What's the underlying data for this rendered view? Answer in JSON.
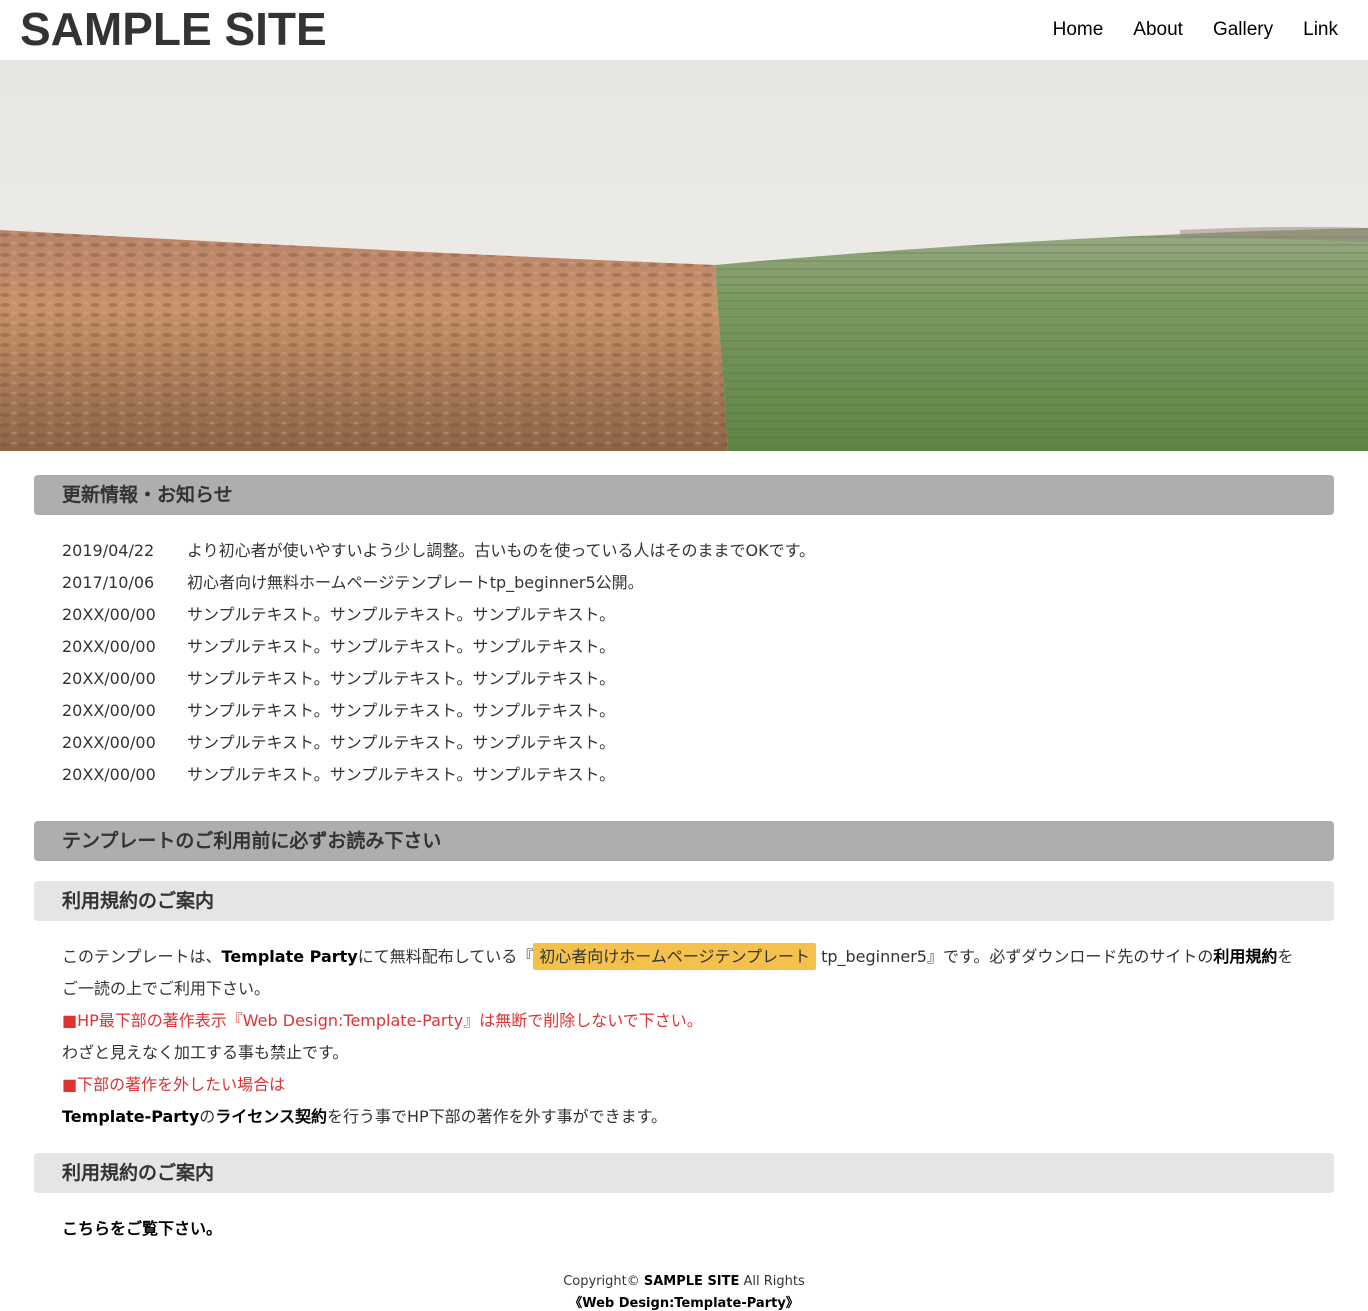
{
  "site": {
    "logo": "SAMPLE SITE"
  },
  "nav": {
    "items": [
      "Home",
      "About",
      "Gallery",
      "Link"
    ]
  },
  "news": {
    "heading": "更新情報・お知らせ",
    "items": [
      {
        "date": "2019/04/22",
        "text": "より初心者が使いやすいよう少し調整。古いものを使っている人はそのままでOKです。"
      },
      {
        "date": "2017/10/06",
        "text": "初心者向け無料ホームページテンプレートtp_beginner5公開。"
      },
      {
        "date": "20XX/00/00",
        "text": "サンプルテキスト。サンプルテキスト。サンプルテキスト。"
      },
      {
        "date": "20XX/00/00",
        "text": "サンプルテキスト。サンプルテキスト。サンプルテキスト。"
      },
      {
        "date": "20XX/00/00",
        "text": "サンプルテキスト。サンプルテキスト。サンプルテキスト。"
      },
      {
        "date": "20XX/00/00",
        "text": "サンプルテキスト。サンプルテキスト。サンプルテキスト。"
      },
      {
        "date": "20XX/00/00",
        "text": "サンプルテキスト。サンプルテキスト。サンプルテキスト。"
      },
      {
        "date": "20XX/00/00",
        "text": "サンプルテキスト。サンプルテキスト。サンプルテキスト。"
      }
    ]
  },
  "readme": {
    "heading": "テンプレートのご利用前に必ずお読み下さい",
    "terms1": {
      "heading": "利用規約のご案内",
      "p1_a": "このテンプレートは、",
      "p1_b": "Template Party",
      "p1_c": "にて無料配布している『",
      "p1_mark": "初心者向けホームページテンプレート",
      "p1_d": " tp_beginner5』です。必ずダウンロード先のサイトの",
      "p1_e": "利用規約",
      "p1_f": "をご一読の上でご利用下さい。",
      "red1": "■HP最下部の著作表示『Web Design:Template-Party』は無断で削除しないで下さい。",
      "p2": "わざと見えなく加工する事も禁止です。",
      "red2": "■下部の著作を外したい場合は",
      "p3_a": "Template-Party",
      "p3_b": "の",
      "p3_c": "ライセンス契約",
      "p3_d": "を行う事でHP下部の著作を外す事ができます。"
    },
    "terms2": {
      "heading": "利用規約のご案内",
      "link": "こちらをご覧下さい。"
    }
  },
  "footer": {
    "copy_a": "Copyright© ",
    "copy_b": "SAMPLE SITE",
    "copy_c": " All Rights",
    "credit": "《Web Design:Template-Party》"
  },
  "colors": {
    "heading_bg": "#aeaeae",
    "subheading_bg": "#e5e5e5",
    "highlight": "#f4c14c",
    "warning_red": "#dd3333"
  }
}
